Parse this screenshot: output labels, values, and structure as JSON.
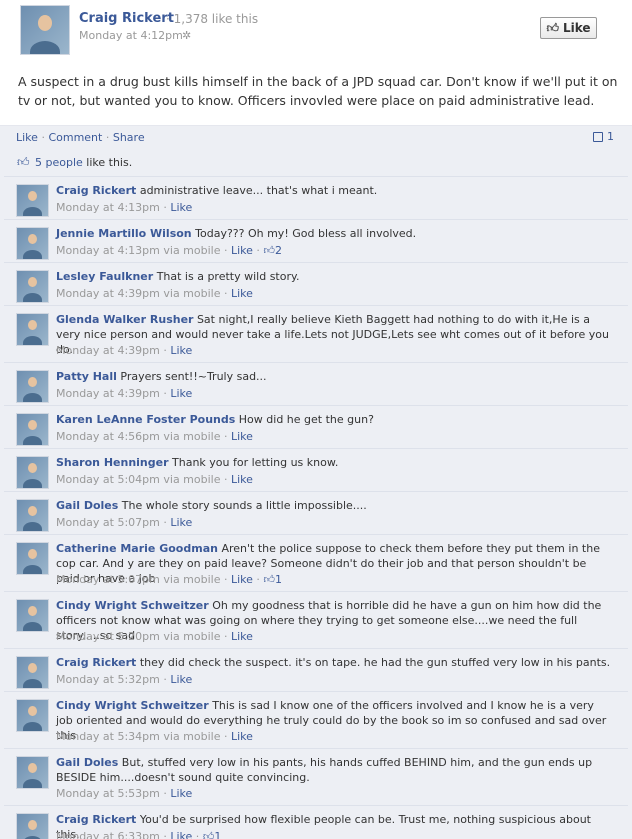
{
  "post": {
    "author": "Craig Rickert",
    "like_count": "· 1,378 like this",
    "timestamp": "Monday at 4:12pm ·",
    "like_button": "Like",
    "text": "A suspect in a drug bust kills himself in the back of a JPD squad car. Don't know if we'll put it on tv or not, but wanted you to know. Officers invovled were place on paid administrative lead."
  },
  "actions": {
    "like": "Like",
    "comment": "Comment",
    "share": "Share",
    "comment_count": "1"
  },
  "likes": {
    "count_link": "5 people",
    "suffix": " like this."
  },
  "comments": [
    {
      "author": "Craig Rickert",
      "text": "administrative leave... that's what i meant.",
      "time": "Monday at 4:13pm",
      "like": "Like",
      "via": "",
      "likes": ""
    },
    {
      "author": "Jennie Martillo Wilson",
      "text": "Today??? Oh my! God bless all involved.",
      "time": "Monday at 4:13pm",
      "like": "Like",
      "via": "via mobile",
      "likes": "2"
    },
    {
      "author": "Lesley Faulkner",
      "text": "That is a pretty wild story.",
      "time": "Monday at 4:39pm",
      "like": "Like",
      "via": "via mobile",
      "likes": ""
    },
    {
      "author": "Glenda Walker Rusher",
      "text": "Sat night,I really believe Kieth Baggett had nothing to do with it,He is a very nice person and would never take a life.Lets not JUDGE,Lets see wht comes out of it before you do.",
      "time": "Monday at 4:39pm",
      "like": "Like",
      "via": "",
      "likes": ""
    },
    {
      "author": "Patty Hall",
      "text": "Prayers sent!!~Truly sad...",
      "time": "Monday at 4:39pm",
      "like": "Like",
      "via": "",
      "likes": ""
    },
    {
      "author": "Karen LeAnne Foster Pounds",
      "text": "How did he get the gun?",
      "time": "Monday at 4:56pm",
      "like": "Like",
      "via": "via mobile",
      "likes": ""
    },
    {
      "author": "Sharon Henninger",
      "text": "Thank you for letting us know.",
      "time": "Monday at 5:04pm",
      "like": "Like",
      "via": "via mobile",
      "likes": ""
    },
    {
      "author": "Gail Doles",
      "text": "The whole story sounds a little impossible....",
      "time": "Monday at 5:07pm",
      "like": "Like",
      "via": "",
      "likes": ""
    },
    {
      "author": "Catherine Marie Goodman",
      "text": "Aren't the police suppose to check them before they put them in the cop car. And y are they on paid leave? Someone didn't do their job and that person shouldn't be paid or have a job",
      "time": "Monday at 5:07pm",
      "like": "Like",
      "via": "via mobile",
      "likes": "1"
    },
    {
      "author": "Cindy Wright Schweitzer",
      "text": "Oh my goodness that is horrible did he have a gun on him how did the officers not know what was going on where they trying to get someone else....we need the full story.....so sad",
      "time": "Monday at 5:20pm",
      "like": "Like",
      "via": "via mobile",
      "likes": ""
    },
    {
      "author": "Craig Rickert",
      "text": "they did check the suspect. it's on tape. he had the gun stuffed very low in his pants.",
      "time": "Monday at 5:32pm",
      "like": "Like",
      "via": "",
      "likes": ""
    },
    {
      "author": "Cindy Wright Schweitzer",
      "text": "This is sad I know one of the officers involved and I know he is a very job oriented and would do everything he truly could do by the book so im so confused and sad over this",
      "time": "Monday at 5:34pm",
      "like": "Like",
      "via": "via mobile",
      "likes": ""
    },
    {
      "author": "Gail Doles",
      "text": "But, stuffed very low in his pants, his hands cuffed BEHIND him, and the gun ends up BESIDE him....doesn't sound quite convincing.",
      "time": "Monday at 5:53pm",
      "like": "Like",
      "via": "",
      "likes": ""
    },
    {
      "author": "Craig Rickert",
      "text": "You'd be surprised how flexible people can be. Trust me, nothing suspicious about this.",
      "time": "Monday at 6:33pm",
      "like": "Like",
      "via": "",
      "likes": "1"
    }
  ]
}
